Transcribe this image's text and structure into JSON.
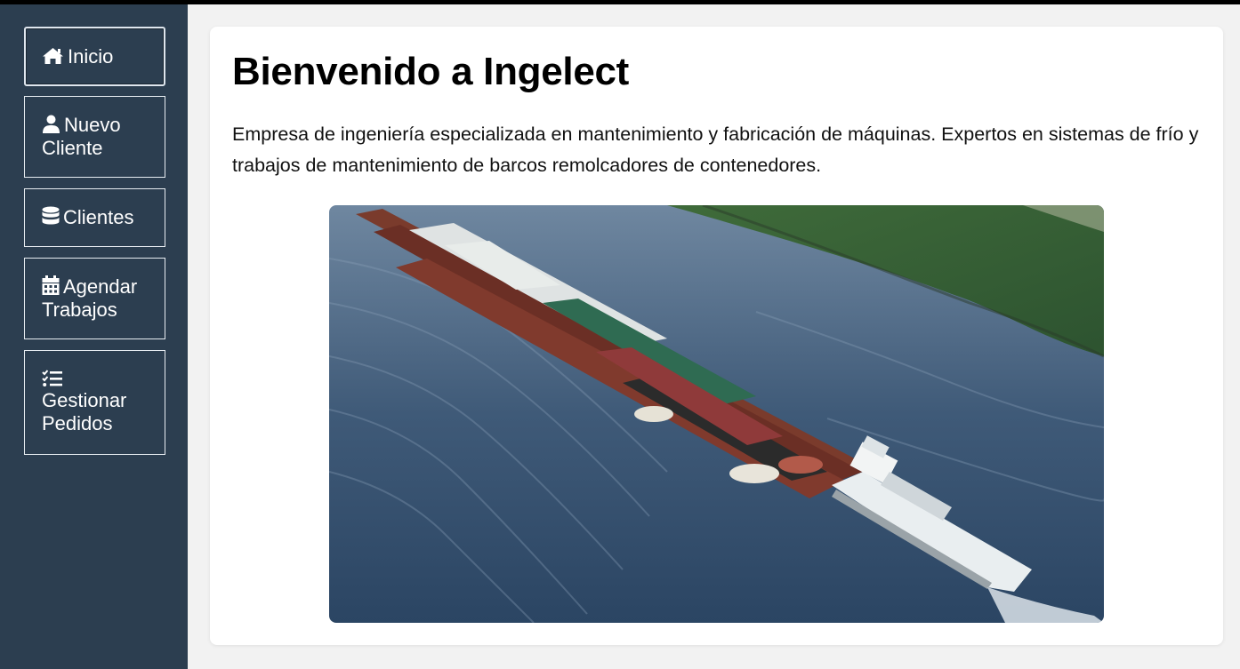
{
  "sidebar": {
    "items": [
      {
        "label": "Inicio",
        "icon": "home-icon",
        "active": true
      },
      {
        "label": "Nuevo Cliente",
        "icon": "user-icon",
        "active": false
      },
      {
        "label": "Clientes",
        "icon": "database-icon",
        "active": false
      },
      {
        "label": "Agendar Trabajos",
        "icon": "calendar-icon",
        "active": false
      },
      {
        "label": "Gestionar Pedidos",
        "icon": "tasks-list-icon",
        "active": false
      }
    ]
  },
  "main": {
    "title": "Bienvenido a Ingelect",
    "description": "Empresa de ingeniería especializada en mantenimiento y fabricación de máquinas. Expertos en sistemas de frío y trabajos de mantenimiento de barcos remolcadores de contenedores.",
    "image_subject": "towboat-pushing-barges-on-river"
  },
  "colors": {
    "sidebar_bg": "#2c3e50",
    "page_bg": "#f2f2f2",
    "card_bg": "#ffffff",
    "text": "#000000"
  }
}
